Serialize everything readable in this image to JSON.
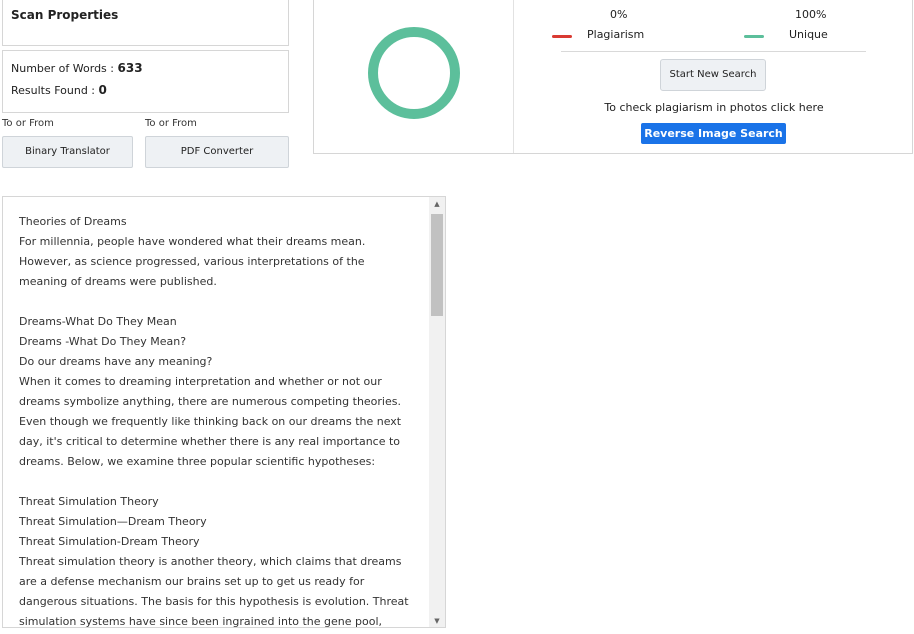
{
  "scan_properties": {
    "title": "Scan Properties",
    "words_label": "Number of Words : ",
    "words_value": "633",
    "results_label": "Results Found : ",
    "results_value": "0"
  },
  "tools": [
    {
      "caption": "To or From",
      "label": "Binary Translator"
    },
    {
      "caption": "To or From",
      "label": "PDF Converter"
    }
  ],
  "results": {
    "plagiarism_percent": "0%",
    "unique_percent": "100%",
    "plagiarism_label": "Plagiarism",
    "unique_label": "Unique",
    "plagiarism_fraction": 0,
    "unique_fraction": 1,
    "start_button": "Start New Search",
    "photo_text": "To check plagiarism in photos click here",
    "reverse_button": "Reverse Image Search"
  },
  "colors": {
    "plagiarism": "#d93a32",
    "unique": "#5cbf9b",
    "accent": "#1a73e8"
  },
  "document_text": "Theories of Dreams\nFor millennia, people have wondered what their dreams mean. However, as science progressed, various interpretations of the meaning of dreams were published.\n\nDreams-What Do They Mean\nDreams -What Do They Mean?\nDo our dreams have any meaning?\nWhen it comes to dreaming interpretation and whether or not our dreams symbolize anything, there are numerous competing theories. Even though we frequently like thinking back on our dreams the next day, it's critical to determine whether there is any real importance to dreams. Below, we examine three popular scientific hypotheses:\n\nThreat Simulation Theory\nThreat Simulation—Dream Theory\nThreat Simulation-Dream Theory\nThreat simulation theory is another theory, which claims that dreams are a defense mechanism our brains set up to get us ready for dangerous situations. The basis for this hypothesis is evolution. Threat simulation systems have since been ingrained into the gene pool,"
}
